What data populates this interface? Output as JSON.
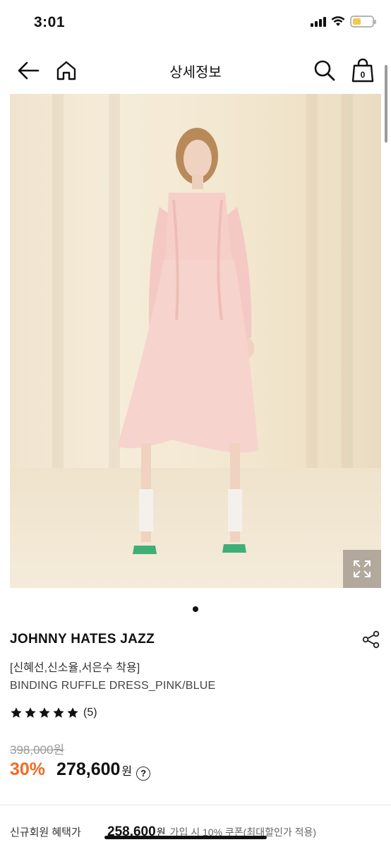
{
  "status_bar": {
    "time": "3:01",
    "icons": [
      "signal-icon",
      "wifi-icon",
      "battery-icon"
    ],
    "battery_color": "#f2c94c"
  },
  "nav": {
    "title": "상세정보",
    "back_icon": "arrow-left-icon",
    "home_icon": "home-icon",
    "search_icon": "search-icon",
    "cart_icon": "shopping-bag-icon",
    "cart_count": "0"
  },
  "product": {
    "image_alt": "model wearing pink ruffle dress",
    "expand_icon": "expand-icon",
    "carousel_dots": 1,
    "brand": "JOHNNY HATES JAZZ",
    "share_icon": "share-icon",
    "promo_text": "[신혜선,신소율,서은수 착용]",
    "name": "BINDING RUFFLE DRESS_PINK/BLUE",
    "rating": {
      "stars": 5,
      "count_text": "(5)"
    },
    "original_price": "398,000원",
    "discount": "30%",
    "sale_price": "278,600",
    "currency": "원",
    "help_icon": "?"
  },
  "benefit": {
    "label": "신규회원 혜택가",
    "price": "258,600",
    "currency": "원",
    "note": "가입 시 10% 쿠폰(최대할인가 적용)"
  },
  "colors": {
    "accent": "#f26a22",
    "text": "#111111",
    "muted": "#9a9a9a"
  }
}
